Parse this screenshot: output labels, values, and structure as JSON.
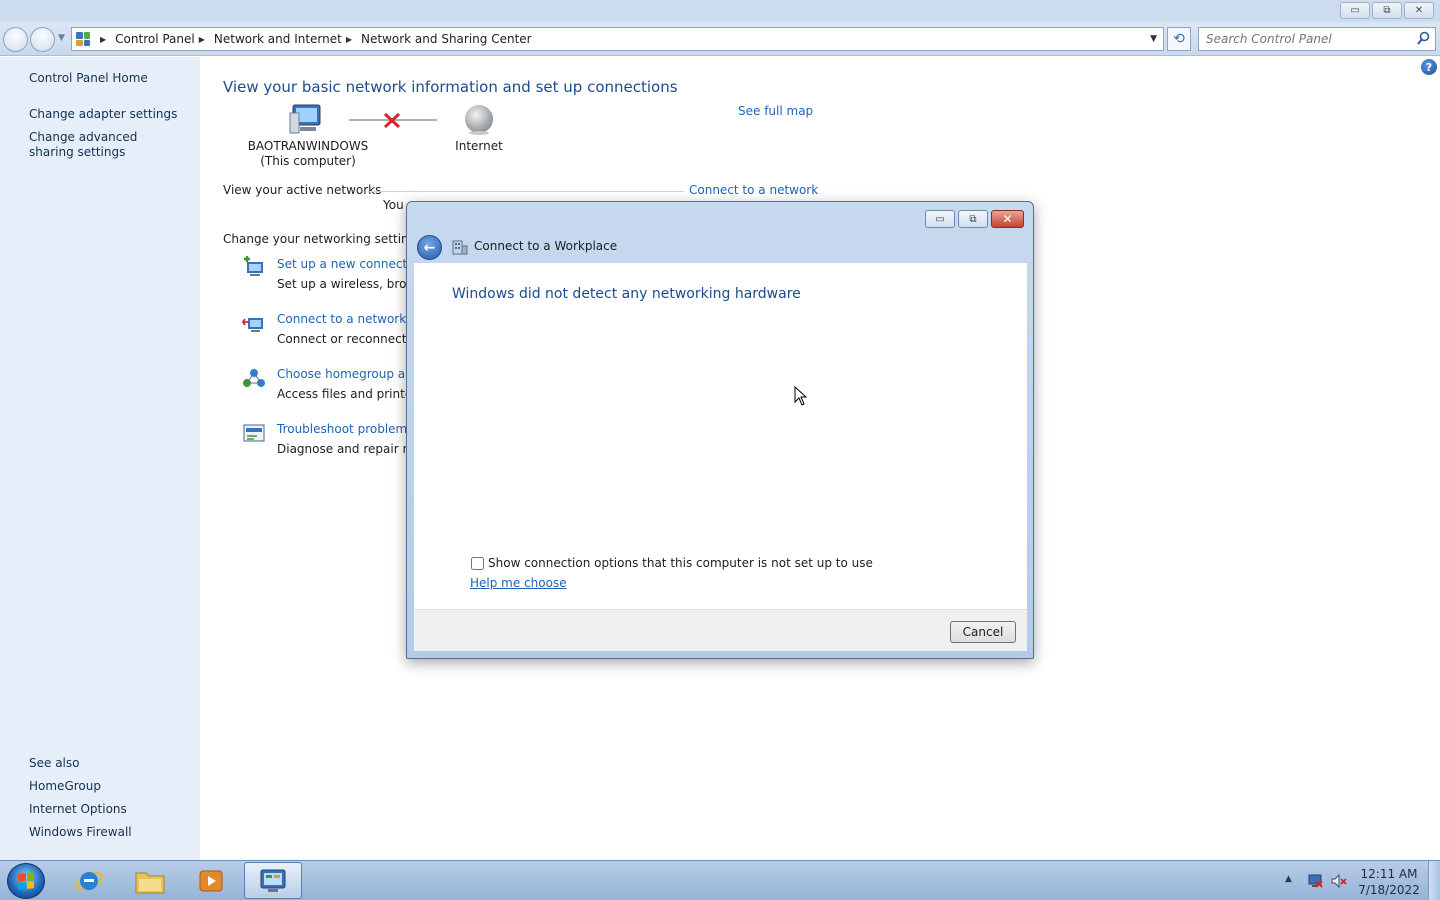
{
  "window": {
    "minimize_glyph": "▭",
    "maximize_glyph": "⧉",
    "close_glyph": "✕"
  },
  "address": {
    "crumbs": [
      "Control Panel",
      "Network and Internet",
      "Network and Sharing Center"
    ],
    "search_placeholder": "Search Control Panel"
  },
  "sidebar": {
    "home": "Control Panel Home",
    "links": [
      "Change adapter settings",
      "Change advanced sharing settings"
    ],
    "see_also_label": "See also",
    "see_also": [
      "HomeGroup",
      "Internet Options",
      "Windows Firewall"
    ]
  },
  "main": {
    "title": "View your basic network information and set up connections",
    "see_full_map": "See full map",
    "computer_name": "BAOTRANWINDOWS",
    "computer_sub": "(This computer)",
    "internet_label": "Internet",
    "active_networks_label": "View your active networks",
    "connect_to_network": "Connect to a network",
    "active_status_partial": "You",
    "change_settings_label": "Change your networking settings",
    "items": [
      {
        "link": "Set up a new connection",
        "desc": "Set up a wireless, broadb",
        "icon": "new-connection-icon"
      },
      {
        "link": "Connect to a network",
        "desc": "Connect or reconnect to",
        "icon": "connect-network-icon"
      },
      {
        "link": "Choose homegroup and",
        "desc": "Access files and printers",
        "icon": "homegroup-icon"
      },
      {
        "link": "Troubleshoot problems",
        "desc": "Diagnose and repair netv",
        "icon": "troubleshoot-icon"
      }
    ]
  },
  "dialog": {
    "title": "Connect to a Workplace",
    "heading": "Windows did not detect any networking hardware",
    "checkbox_label": "Show connection options that this computer is not set up to use",
    "checkbox_checked": false,
    "help_link": "Help me choose",
    "cancel": "Cancel"
  },
  "taskbar": {
    "time": "12:11 AM",
    "date": "7/18/2022",
    "apps": [
      "internet-explorer-icon",
      "file-explorer-icon",
      "media-player-icon",
      "control-panel-icon"
    ],
    "active_app": "control-panel-icon"
  },
  "colors": {
    "link": "#1e64b4",
    "heading": "#1e4b8e",
    "sidebar_bg": "#e6eff9",
    "disconnect_x": "#d8242a"
  }
}
